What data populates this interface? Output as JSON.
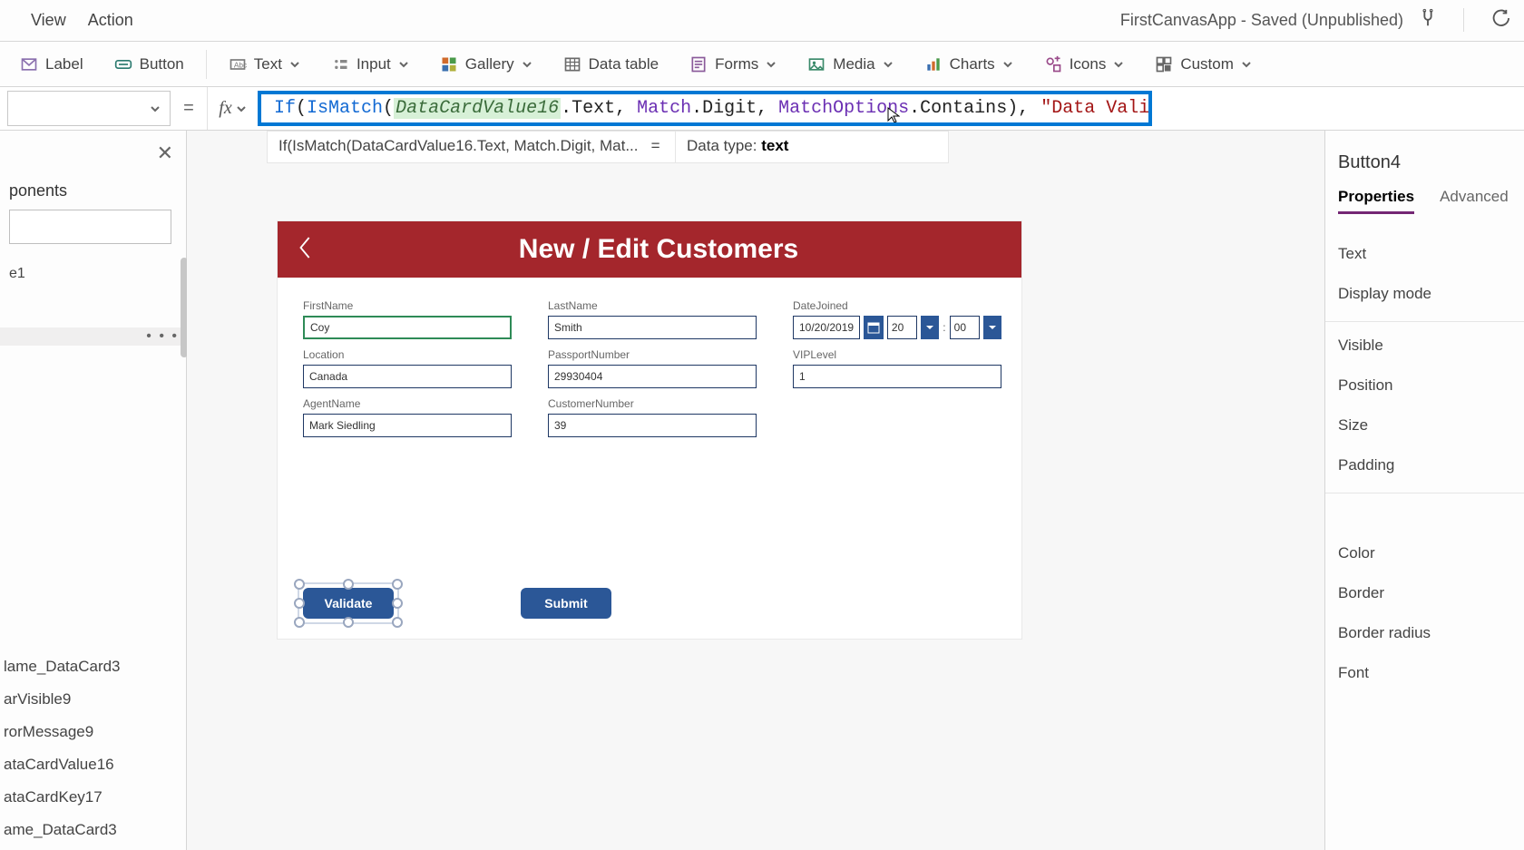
{
  "app": {
    "title": "FirstCanvasApp - Saved (Unpublished)",
    "menus": [
      "View",
      "Action"
    ]
  },
  "ribbon": {
    "label_label": "Label",
    "button_label": "Button",
    "text_label": "Text",
    "input_label": "Input",
    "gallery_label": "Gallery",
    "datatable_label": "Data table",
    "forms_label": "Forms",
    "media_label": "Media",
    "charts_label": "Charts",
    "icons_label": "Icons",
    "custom_label": "Custom"
  },
  "formula": {
    "equals": "=",
    "fx": "fx",
    "tokens": {
      "t1": "If",
      "p1": "(",
      "t2": "IsMatch",
      "p2": "(",
      "dc": "DataCardValue16",
      "dot1": ".Text, ",
      "t3": "Match",
      "dot2": ".Digit, ",
      "t4": "MatchOptions",
      "dot3": ".Contains), ",
      "str1": "\"Data Validation Error\"",
      "comma": ", ",
      "str2": "\"\"",
      "close": ")"
    },
    "info_left": "If(IsMatch(DataCardValue16.Text, Match.Digit, Mat...",
    "info_eq": "=",
    "info_right_label": "Data type: ",
    "info_right_value": "text"
  },
  "leftpanel": {
    "header": "ponents",
    "items_top": [
      "e1",
      ""
    ],
    "items_bottom": [
      "lame_DataCard3",
      "arVisible9",
      "rorMessage9",
      "ataCardValue16",
      "ataCardKey17",
      "ame_DataCard3"
    ]
  },
  "canvas": {
    "banner_title": "New / Edit Customers",
    "fields": {
      "firstname": {
        "label": "FirstName",
        "value": "Coy"
      },
      "lastname": {
        "label": "LastName",
        "value": "Smith"
      },
      "datejoined": {
        "label": "DateJoined",
        "date": "10/20/2019",
        "hh": "20",
        "mm": "00"
      },
      "location": {
        "label": "Location",
        "value": "Canada"
      },
      "passport": {
        "label": "PassportNumber",
        "value": "29930404"
      },
      "vip": {
        "label": "VIPLevel",
        "value": "1"
      },
      "agent": {
        "label": "AgentName",
        "value": "Mark Siedling"
      },
      "custno": {
        "label": "CustomerNumber",
        "value": "39"
      }
    },
    "buttons": {
      "validate": "Validate",
      "submit": "Submit"
    }
  },
  "rightpanel": {
    "control_name": "Button4",
    "tabs": {
      "properties": "Properties",
      "advanced": "Advanced"
    },
    "props_group1": [
      "Text",
      "Display mode"
    ],
    "props_group2": [
      "Visible",
      "Position",
      "Size",
      "Padding"
    ],
    "props_group3": [
      "Color",
      "Border",
      "Border radius",
      "Font"
    ]
  }
}
